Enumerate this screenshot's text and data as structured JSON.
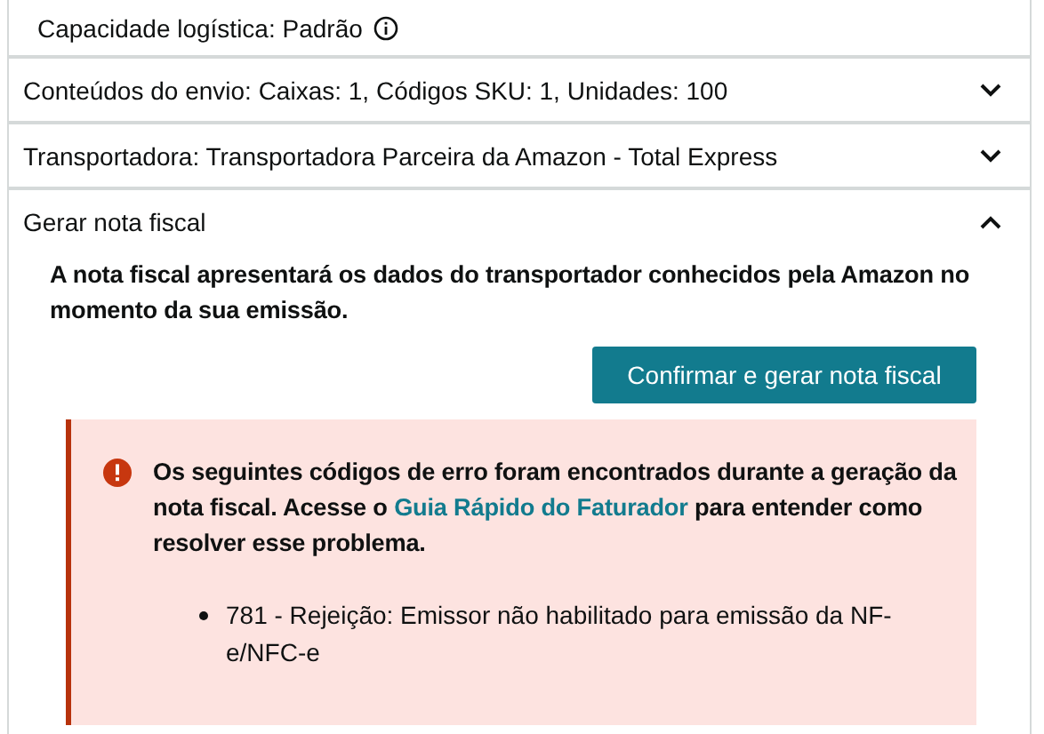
{
  "capacity": {
    "label": "Capacidade logística: Padrão"
  },
  "sections": [
    {
      "title": "Conteúdos do envio: Caixas: 1, Códigos SKU: 1, Unidades: 100",
      "expanded": false
    },
    {
      "title": "Transportadora: Transportadora Parceira da Amazon - Total Express",
      "expanded": false
    },
    {
      "title": "Gerar nota fiscal",
      "expanded": true
    }
  ],
  "invoice": {
    "note": "A nota fiscal apresentará os dados do transportador conhecidos pela Amazon no momento da sua emissão.",
    "button": "Confirmar e gerar nota fiscal",
    "alert": {
      "text_before": "Os seguintes códigos de erro foram encontrados durante a geração da nota fiscal. Acesse o",
      "link": "Guia Rápido do Faturador",
      "text_after": "para entender como resolver esse problema.",
      "errors": [
        "781 - Rejeição: Emissor não habilitado para emissão da NF-e/NFC-e"
      ]
    }
  }
}
